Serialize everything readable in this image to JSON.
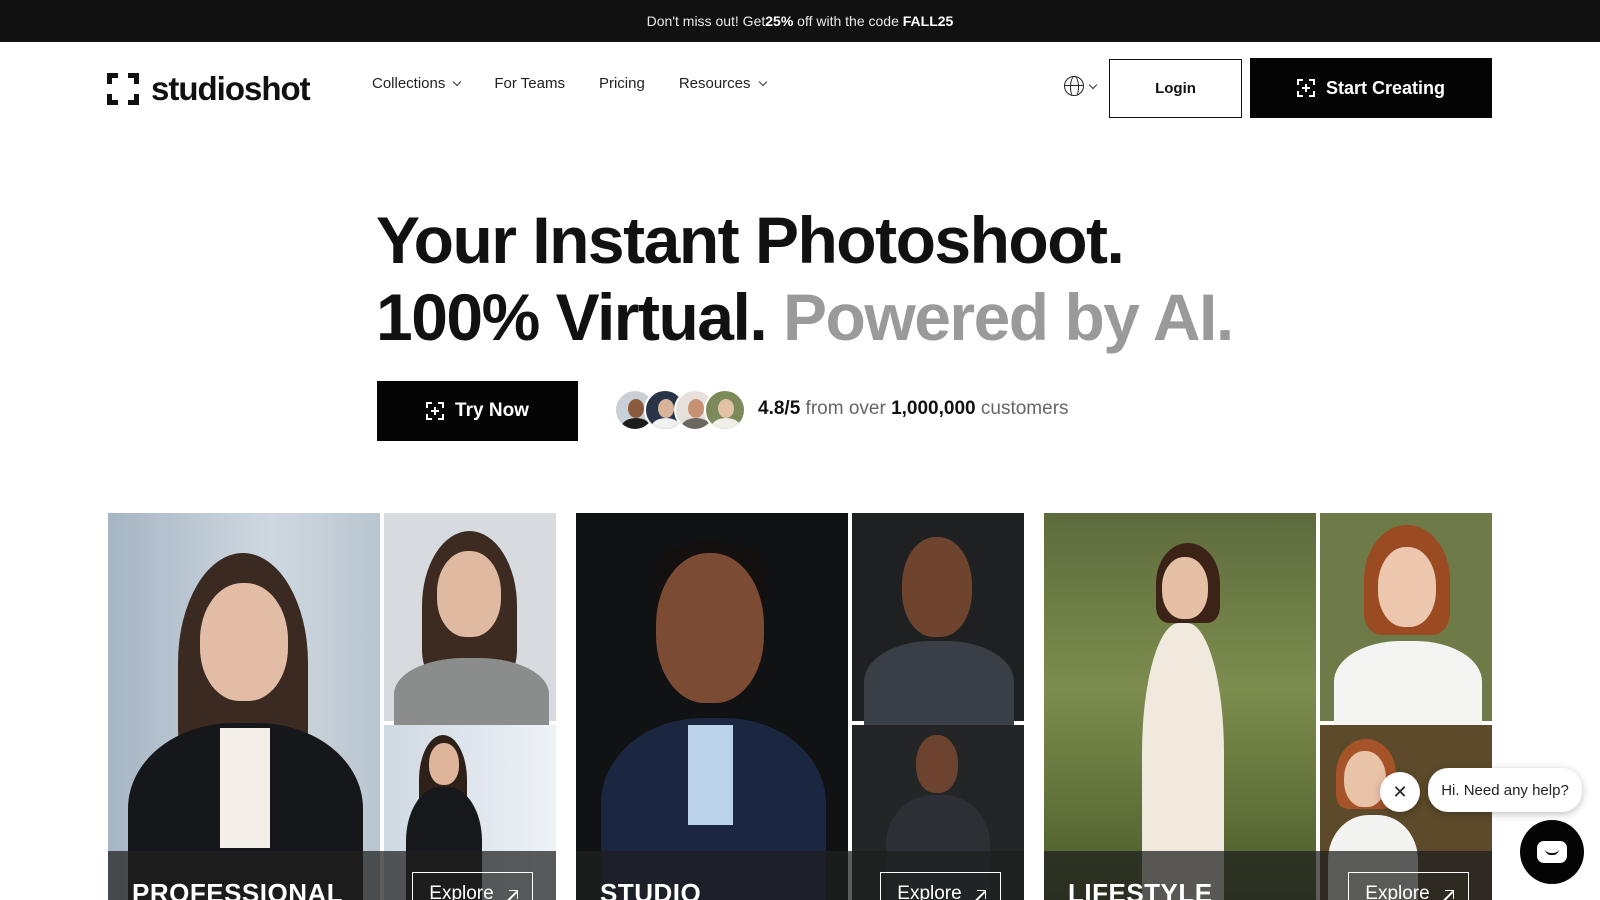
{
  "promo": {
    "prefix": "Don't miss out! Get ",
    "discount": "25%",
    "middle": " off with the code ",
    "code": "FALL25"
  },
  "brand": {
    "name": "studioshot"
  },
  "nav": {
    "items": [
      {
        "label": "Collections",
        "has_dropdown": true
      },
      {
        "label": "For Teams",
        "has_dropdown": false
      },
      {
        "label": "Pricing",
        "has_dropdown": false
      },
      {
        "label": "Resources",
        "has_dropdown": true
      }
    ],
    "language_icon": "globe-icon",
    "login_label": "Login",
    "cta_label": "Start Creating"
  },
  "hero": {
    "line1": "Your Instant Photoshoot.",
    "line2_dark": "100% Virtual.",
    "line2_gray": "Powered by AI.",
    "try_label": "Try Now",
    "rating_value": "4.8/5",
    "rating_from": " from over ",
    "customer_count": "1,000,000",
    "rating_suffix": " customers"
  },
  "collections": [
    {
      "label": "PROFESSIONAL",
      "explore_label": "Explore"
    },
    {
      "label": "STUDIO",
      "explore_label": "Explore"
    },
    {
      "label": "LIFESTYLE",
      "explore_label": "Explore"
    }
  ],
  "chat": {
    "greeting": "Hi. Need any help?",
    "close_glyph": "✕"
  },
  "colors": {
    "primary": "#050505",
    "promo_bg": "#111111",
    "hero_gray": "#9a9a9a",
    "text": "#111111"
  }
}
